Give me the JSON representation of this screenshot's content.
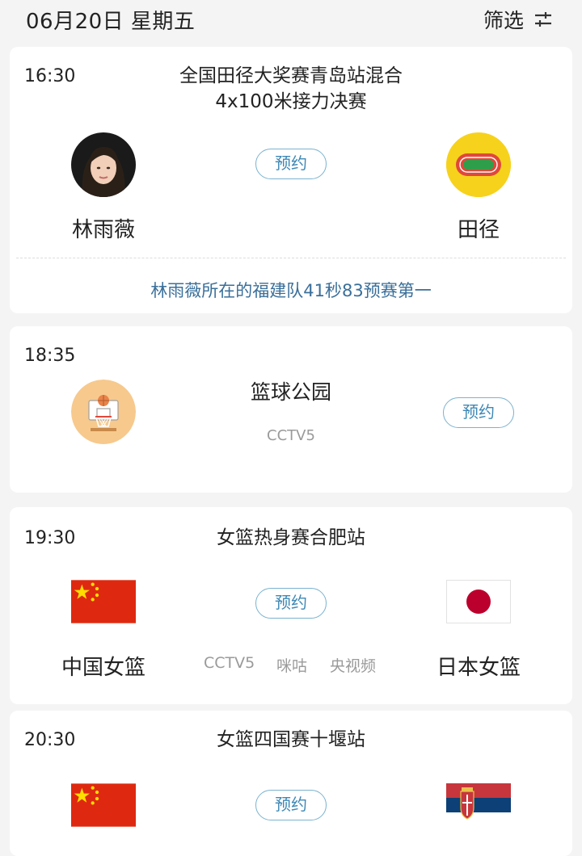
{
  "header": {
    "date": "06月20日 星期五",
    "filter_label": "筛选"
  },
  "events": [
    {
      "time": "16:30",
      "title_line1": "全国田径大奖赛青岛站混合",
      "title_line2": "4x100米接力决赛",
      "left_name": "林雨薇",
      "right_name": "田径",
      "book_label": "预约",
      "note": "林雨薇所在的福建队41秒83预赛第一"
    },
    {
      "time": "18:35",
      "title": "篮球公园",
      "channel": "CCTV5",
      "book_label": "预约"
    },
    {
      "time": "19:30",
      "title": "女篮热身赛合肥站",
      "left_name": "中国女篮",
      "right_name": "日本女篮",
      "book_label": "预约",
      "channels": [
        "CCTV5",
        "咪咕",
        "央视频"
      ]
    },
    {
      "time": "20:30",
      "title": "女篮四国赛十堰站",
      "book_label": "预约"
    }
  ],
  "colors": {
    "accent": "#3e88b5",
    "note": "#3a6f9a",
    "china_red": "#de2910",
    "china_star": "#ffde00",
    "japan_red": "#bc002d",
    "track_yellow": "#f6d21c",
    "track_red": "#e0473a",
    "track_green": "#2f9e4a"
  }
}
